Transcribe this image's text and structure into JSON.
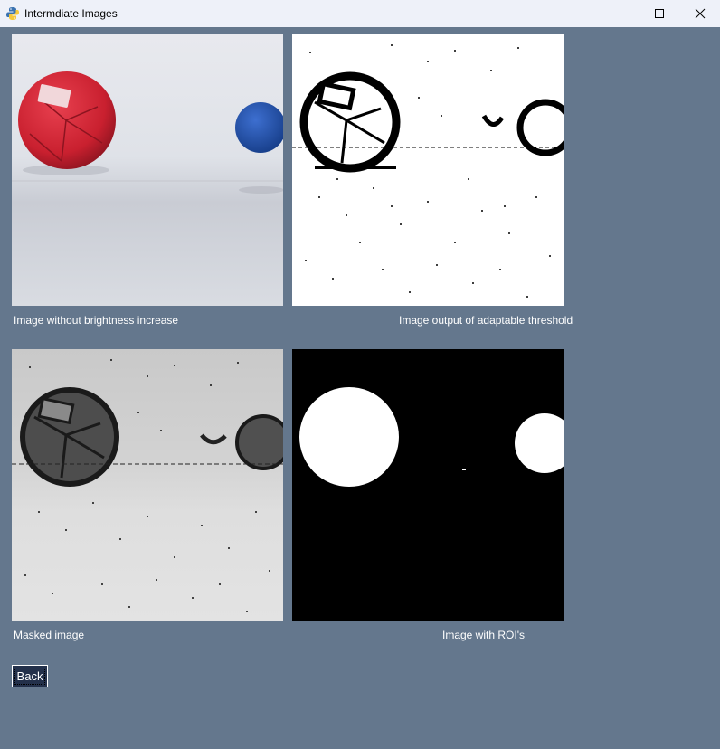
{
  "window": {
    "title": "Intermdiate Images",
    "controls": {
      "minimize": "minimize",
      "maximize": "maximize",
      "close": "close"
    }
  },
  "panels": [
    {
      "caption": "Image without brightness increase",
      "kind": "color-photo"
    },
    {
      "caption": "Image output of adaptable threshold",
      "kind": "binary-threshold"
    },
    {
      "caption": "Masked image",
      "kind": "grayscale-masked"
    },
    {
      "caption": "Image with ROI's",
      "kind": "roi-mask"
    }
  ],
  "back_button": {
    "label": "Back"
  },
  "colors": {
    "background": "#64778d",
    "titlebar": "#eef1f9",
    "red_ball": "#d1283a",
    "blue_ball": "#1f4fa8",
    "button_bg": "#23304a"
  }
}
